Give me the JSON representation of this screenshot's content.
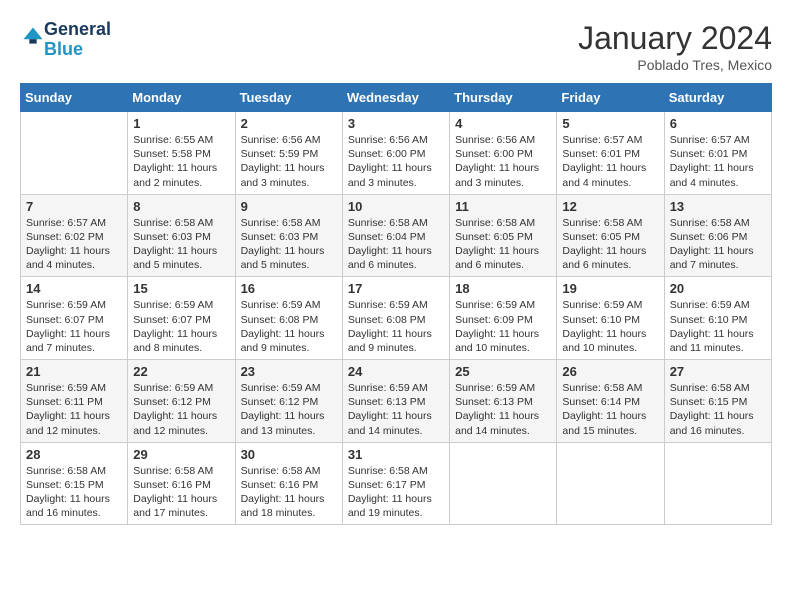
{
  "header": {
    "logo_line1": "General",
    "logo_line2": "Blue",
    "month_year": "January 2024",
    "location": "Poblado Tres, Mexico"
  },
  "days_of_week": [
    "Sunday",
    "Monday",
    "Tuesday",
    "Wednesday",
    "Thursday",
    "Friday",
    "Saturday"
  ],
  "weeks": [
    [
      {
        "day": "",
        "lines": []
      },
      {
        "day": "1",
        "lines": [
          "Sunrise: 6:55 AM",
          "Sunset: 5:58 PM",
          "Daylight: 11 hours",
          "and 2 minutes."
        ]
      },
      {
        "day": "2",
        "lines": [
          "Sunrise: 6:56 AM",
          "Sunset: 5:59 PM",
          "Daylight: 11 hours",
          "and 3 minutes."
        ]
      },
      {
        "day": "3",
        "lines": [
          "Sunrise: 6:56 AM",
          "Sunset: 6:00 PM",
          "Daylight: 11 hours",
          "and 3 minutes."
        ]
      },
      {
        "day": "4",
        "lines": [
          "Sunrise: 6:56 AM",
          "Sunset: 6:00 PM",
          "Daylight: 11 hours",
          "and 3 minutes."
        ]
      },
      {
        "day": "5",
        "lines": [
          "Sunrise: 6:57 AM",
          "Sunset: 6:01 PM",
          "Daylight: 11 hours",
          "and 4 minutes."
        ]
      },
      {
        "day": "6",
        "lines": [
          "Sunrise: 6:57 AM",
          "Sunset: 6:01 PM",
          "Daylight: 11 hours",
          "and 4 minutes."
        ]
      }
    ],
    [
      {
        "day": "7",
        "lines": [
          "Sunrise: 6:57 AM",
          "Sunset: 6:02 PM",
          "Daylight: 11 hours",
          "and 4 minutes."
        ]
      },
      {
        "day": "8",
        "lines": [
          "Sunrise: 6:58 AM",
          "Sunset: 6:03 PM",
          "Daylight: 11 hours",
          "and 5 minutes."
        ]
      },
      {
        "day": "9",
        "lines": [
          "Sunrise: 6:58 AM",
          "Sunset: 6:03 PM",
          "Daylight: 11 hours",
          "and 5 minutes."
        ]
      },
      {
        "day": "10",
        "lines": [
          "Sunrise: 6:58 AM",
          "Sunset: 6:04 PM",
          "Daylight: 11 hours",
          "and 6 minutes."
        ]
      },
      {
        "day": "11",
        "lines": [
          "Sunrise: 6:58 AM",
          "Sunset: 6:05 PM",
          "Daylight: 11 hours",
          "and 6 minutes."
        ]
      },
      {
        "day": "12",
        "lines": [
          "Sunrise: 6:58 AM",
          "Sunset: 6:05 PM",
          "Daylight: 11 hours",
          "and 6 minutes."
        ]
      },
      {
        "day": "13",
        "lines": [
          "Sunrise: 6:58 AM",
          "Sunset: 6:06 PM",
          "Daylight: 11 hours",
          "and 7 minutes."
        ]
      }
    ],
    [
      {
        "day": "14",
        "lines": [
          "Sunrise: 6:59 AM",
          "Sunset: 6:07 PM",
          "Daylight: 11 hours",
          "and 7 minutes."
        ]
      },
      {
        "day": "15",
        "lines": [
          "Sunrise: 6:59 AM",
          "Sunset: 6:07 PM",
          "Daylight: 11 hours",
          "and 8 minutes."
        ]
      },
      {
        "day": "16",
        "lines": [
          "Sunrise: 6:59 AM",
          "Sunset: 6:08 PM",
          "Daylight: 11 hours",
          "and 9 minutes."
        ]
      },
      {
        "day": "17",
        "lines": [
          "Sunrise: 6:59 AM",
          "Sunset: 6:08 PM",
          "Daylight: 11 hours",
          "and 9 minutes."
        ]
      },
      {
        "day": "18",
        "lines": [
          "Sunrise: 6:59 AM",
          "Sunset: 6:09 PM",
          "Daylight: 11 hours",
          "and 10 minutes."
        ]
      },
      {
        "day": "19",
        "lines": [
          "Sunrise: 6:59 AM",
          "Sunset: 6:10 PM",
          "Daylight: 11 hours",
          "and 10 minutes."
        ]
      },
      {
        "day": "20",
        "lines": [
          "Sunrise: 6:59 AM",
          "Sunset: 6:10 PM",
          "Daylight: 11 hours",
          "and 11 minutes."
        ]
      }
    ],
    [
      {
        "day": "21",
        "lines": [
          "Sunrise: 6:59 AM",
          "Sunset: 6:11 PM",
          "Daylight: 11 hours",
          "and 12 minutes."
        ]
      },
      {
        "day": "22",
        "lines": [
          "Sunrise: 6:59 AM",
          "Sunset: 6:12 PM",
          "Daylight: 11 hours",
          "and 12 minutes."
        ]
      },
      {
        "day": "23",
        "lines": [
          "Sunrise: 6:59 AM",
          "Sunset: 6:12 PM",
          "Daylight: 11 hours",
          "and 13 minutes."
        ]
      },
      {
        "day": "24",
        "lines": [
          "Sunrise: 6:59 AM",
          "Sunset: 6:13 PM",
          "Daylight: 11 hours",
          "and 14 minutes."
        ]
      },
      {
        "day": "25",
        "lines": [
          "Sunrise: 6:59 AM",
          "Sunset: 6:13 PM",
          "Daylight: 11 hours",
          "and 14 minutes."
        ]
      },
      {
        "day": "26",
        "lines": [
          "Sunrise: 6:58 AM",
          "Sunset: 6:14 PM",
          "Daylight: 11 hours",
          "and 15 minutes."
        ]
      },
      {
        "day": "27",
        "lines": [
          "Sunrise: 6:58 AM",
          "Sunset: 6:15 PM",
          "Daylight: 11 hours",
          "and 16 minutes."
        ]
      }
    ],
    [
      {
        "day": "28",
        "lines": [
          "Sunrise: 6:58 AM",
          "Sunset: 6:15 PM",
          "Daylight: 11 hours",
          "and 16 minutes."
        ]
      },
      {
        "day": "29",
        "lines": [
          "Sunrise: 6:58 AM",
          "Sunset: 6:16 PM",
          "Daylight: 11 hours",
          "and 17 minutes."
        ]
      },
      {
        "day": "30",
        "lines": [
          "Sunrise: 6:58 AM",
          "Sunset: 6:16 PM",
          "Daylight: 11 hours",
          "and 18 minutes."
        ]
      },
      {
        "day": "31",
        "lines": [
          "Sunrise: 6:58 AM",
          "Sunset: 6:17 PM",
          "Daylight: 11 hours",
          "and 19 minutes."
        ]
      },
      {
        "day": "",
        "lines": []
      },
      {
        "day": "",
        "lines": []
      },
      {
        "day": "",
        "lines": []
      }
    ]
  ]
}
